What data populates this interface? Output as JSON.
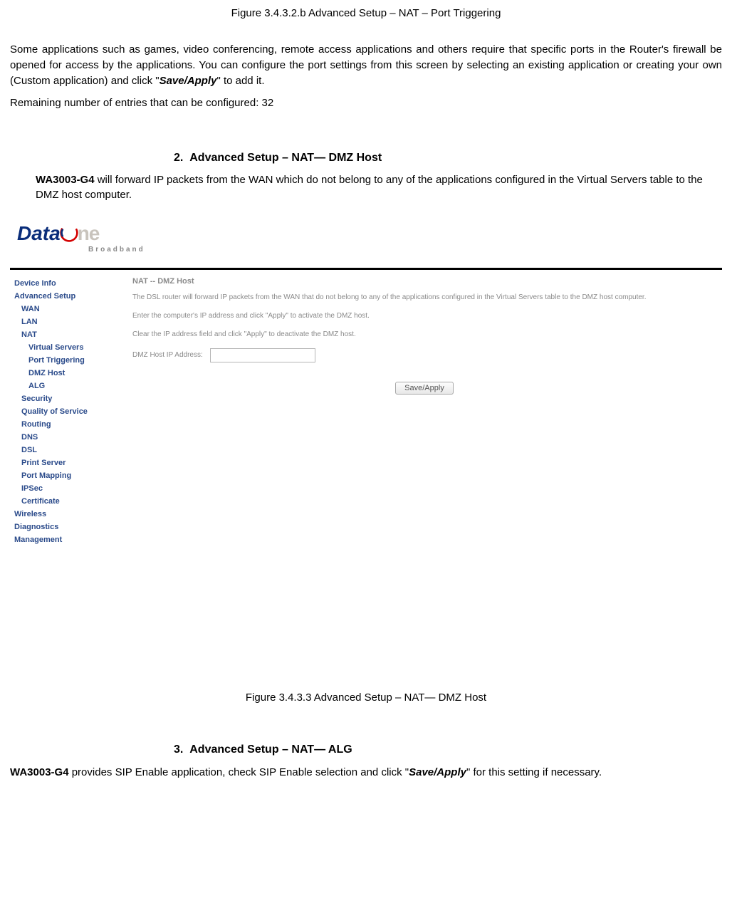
{
  "captions": {
    "top": "Figure 3.4.3.2.b Advanced Setup – NAT – Port Triggering",
    "mid": "Figure 3.4.3.3 Advanced Setup – NAT— DMZ Host"
  },
  "intro": {
    "p1a": "Some applications such as games, video conferencing, remote access applications and others require that specific ports in the Router's firewall be opened for access by the applications. You can configure the port settings from this screen by selecting an existing application or creating your own (Custom application) and click \"",
    "p1b_bi": "Save/Apply",
    "p1c": "\" to add it.",
    "remaining": "Remaining number of entries that can be configured: 32"
  },
  "section2": {
    "num": "2.",
    "title": "Advanced Setup – NAT— DMZ Host",
    "bold": "WA3003-G4",
    "rest": " will forward IP packets from the WAN which do not belong to any of the applications configured in the Virtual Servers table to the DMZ host computer."
  },
  "router": {
    "logo_data": "Data",
    "logo_ne": "ne",
    "logo_sub": "Broadband",
    "nav": [
      {
        "label": "Device Info",
        "cls": "lvl0",
        "name": "nav-device-info"
      },
      {
        "label": "Advanced Setup",
        "cls": "lvl0",
        "name": "nav-advanced-setup"
      },
      {
        "label": "WAN",
        "cls": "lvl1",
        "name": "nav-wan"
      },
      {
        "label": "LAN",
        "cls": "lvl1",
        "name": "nav-lan"
      },
      {
        "label": "NAT",
        "cls": "lvl1",
        "name": "nav-nat"
      },
      {
        "label": "Virtual Servers",
        "cls": "lvl2",
        "name": "nav-virtual-servers"
      },
      {
        "label": "Port Triggering",
        "cls": "lvl2",
        "name": "nav-port-triggering"
      },
      {
        "label": "DMZ Host",
        "cls": "lvl2",
        "name": "nav-dmz-host"
      },
      {
        "label": "ALG",
        "cls": "lvl2",
        "name": "nav-alg"
      },
      {
        "label": "Security",
        "cls": "lvl1",
        "name": "nav-security"
      },
      {
        "label": "Quality of Service",
        "cls": "lvl1",
        "name": "nav-qos"
      },
      {
        "label": "Routing",
        "cls": "lvl1",
        "name": "nav-routing"
      },
      {
        "label": "DNS",
        "cls": "lvl1",
        "name": "nav-dns"
      },
      {
        "label": "DSL",
        "cls": "lvl1",
        "name": "nav-dsl"
      },
      {
        "label": "Print Server",
        "cls": "lvl1",
        "name": "nav-print-server"
      },
      {
        "label": "Port Mapping",
        "cls": "lvl1",
        "name": "nav-port-mapping"
      },
      {
        "label": "IPSec",
        "cls": "lvl1",
        "name": "nav-ipsec"
      },
      {
        "label": "Certificate",
        "cls": "lvl1",
        "name": "nav-certificate"
      },
      {
        "label": "Wireless",
        "cls": "lvl0",
        "name": "nav-wireless"
      },
      {
        "label": "Diagnostics",
        "cls": "lvl0",
        "name": "nav-diagnostics"
      },
      {
        "label": "Management",
        "cls": "lvl0",
        "name": "nav-management"
      }
    ],
    "content": {
      "title": "NAT -- DMZ Host",
      "l1": "The DSL router will forward IP packets from the WAN that do not belong to any of the applications configured in the Virtual Servers table to the DMZ host computer.",
      "l2": "Enter the computer's IP address and click \"Apply\" to activate the DMZ host.",
      "l3": "Clear the IP address field and click \"Apply\" to deactivate the DMZ host.",
      "ip_label": "DMZ Host IP Address:",
      "btn": "Save/Apply"
    }
  },
  "section3": {
    "num": "3.",
    "title": "Advanced Setup – NAT— ALG",
    "bold": "WA3003-G4",
    "mid": " provides SIP Enable application, check SIP Enable selection and click \"",
    "bi": "Save/Apply",
    "end": "\" for this setting if necessary."
  }
}
